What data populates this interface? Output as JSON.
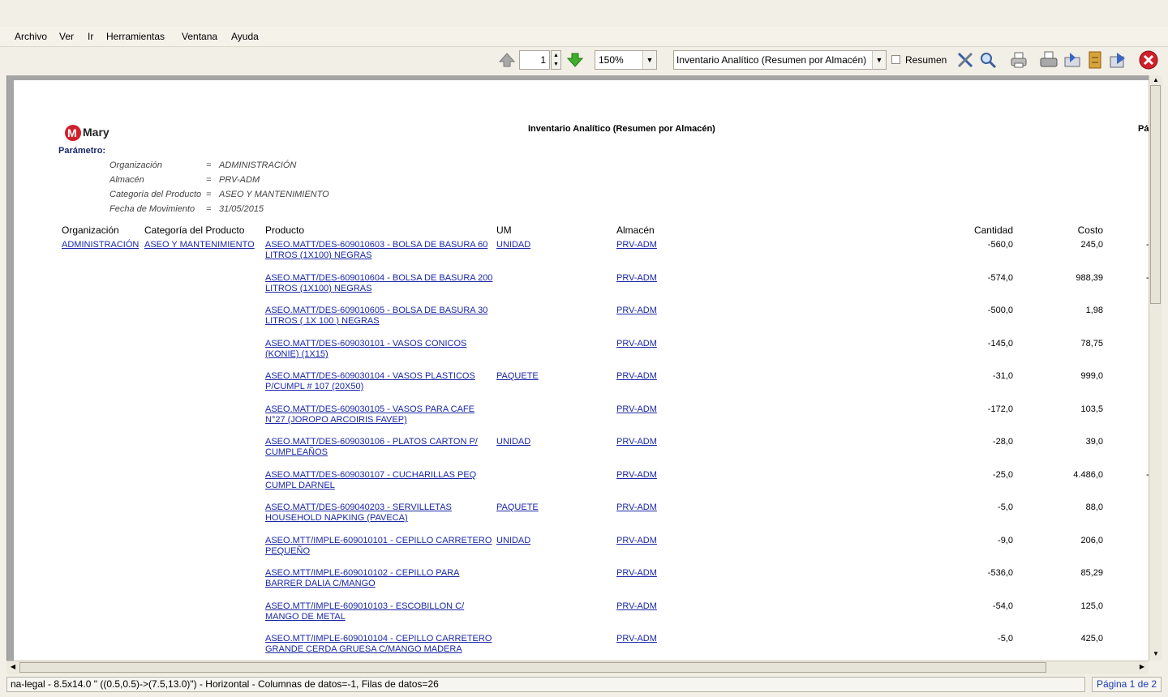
{
  "menu": [
    "Archivo",
    "Ver",
    "Ir",
    "Herramientas",
    "Ventana",
    "Ayuda"
  ],
  "toolbar": {
    "page_value": "1",
    "zoom": "150%",
    "report": "Inventario Analítico (Resumen por Almacén)",
    "summary_label": "Resumen",
    "summary_checked": false
  },
  "report": {
    "logo_text": "Mary",
    "title": "Inventario Analítico (Resumen por Almacén)",
    "page_label_cut": "Pá",
    "param_heading": "Parámetro:",
    "params": [
      {
        "label": "Organización",
        "eq": "=",
        "value": "ADMINISTRACIÓN"
      },
      {
        "label": "Almacén",
        "eq": "=",
        "value": "PRV-ADM"
      },
      {
        "label": "Categoría del Producto",
        "eq": "=",
        "value": "ASEO Y MANTENIMIENTO"
      },
      {
        "label": "Fecha de Movimiento",
        "eq": "=",
        "value": "31/05/2015"
      }
    ],
    "columns": {
      "org": "Organización",
      "cat": "Categoría del Producto",
      "prod": "Producto",
      "um": "UM",
      "alm": "Almacén",
      "cant": "Cantidad",
      "costo": "Costo"
    },
    "org": "ADMINISTRACIÓN",
    "cat": "ASEO Y MANTENIMIENTO",
    "rows": [
      {
        "prod": "ASEO.MATT/DES-609010603 - BOLSA DE BASURA 60 LITROS (1X100) NEGRAS",
        "um": "UNIDAD",
        "alm": "PRV-ADM",
        "cant": "-560,0",
        "costo": "245,0",
        "tail": "-"
      },
      {
        "prod": "ASEO.MATT/DES-609010604 - BOLSA DE BASURA 200 LITROS (1X100) NEGRAS",
        "um": "",
        "alm": "PRV-ADM",
        "cant": "-574,0",
        "costo": "988,39",
        "tail": "-"
      },
      {
        "prod": "ASEO.MATT/DES-609010605 - BOLSA DE BASURA  30 LITROS  ( 1X 100 ) NEGRAS",
        "um": "",
        "alm": "PRV-ADM",
        "cant": "-500,0",
        "costo": "1,98",
        "tail": ""
      },
      {
        "prod": "ASEO.MATT/DES-609030101 - VASOS CONICOS (KONIE) (1X15)",
        "um": "",
        "alm": "PRV-ADM",
        "cant": "-145,0",
        "costo": "78,75",
        "tail": ""
      },
      {
        "prod": "ASEO.MATT/DES-609030104 - VASOS PLASTICOS P/CUMPL # 107 (20X50)",
        "um": "PAQUETE",
        "alm": "PRV-ADM",
        "cant": "-31,0",
        "costo": "999,0",
        "tail": ""
      },
      {
        "prod": "ASEO.MATT/DES-609030105 - VASOS PARA CAFE N°27 (JOROPO ARCOIRIS FAVEP)",
        "um": "",
        "alm": "PRV-ADM",
        "cant": "-172,0",
        "costo": "103,5",
        "tail": ""
      },
      {
        "prod": "ASEO.MATT/DES-609030106 - PLATOS  CARTON P/ CUMPLEAÑOS",
        "um": "UNIDAD",
        "alm": "PRV-ADM",
        "cant": "-28,0",
        "costo": "39,0",
        "tail": ""
      },
      {
        "prod": "ASEO.MATT/DES-609030107 - CUCHARILLAS PEQ  CUMPL DARNEL",
        "um": "",
        "alm": "PRV-ADM",
        "cant": "-25,0",
        "costo": "4.486,0",
        "tail": "-"
      },
      {
        "prod": "ASEO.MATT/DES-609040203 - SERVILLETAS  HOUSEHOLD NAPKING (PAVECA)",
        "um": "PAQUETE",
        "alm": "PRV-ADM",
        "cant": "-5,0",
        "costo": "88,0",
        "tail": ""
      },
      {
        "prod": "ASEO.MTT/IMPLE-609010101 - CEPILLO CARRETERO PEQUEÑO",
        "um": "UNIDAD",
        "alm": "PRV-ADM",
        "cant": "-9,0",
        "costo": "206,0",
        "tail": ""
      },
      {
        "prod": "ASEO.MTT/IMPLE-609010102 - CEPILLO PARA BARRER DALIA C/MANGO",
        "um": "",
        "alm": "PRV-ADM",
        "cant": "-536,0",
        "costo": "85,29",
        "tail": ""
      },
      {
        "prod": "ASEO.MTT/IMPLE-609010103 - ESCOBILLON C/ MANGO DE METAL",
        "um": "",
        "alm": "PRV-ADM",
        "cant": "-54,0",
        "costo": "125,0",
        "tail": ""
      },
      {
        "prod": "ASEO.MTT/IMPLE-609010104 - CEPILLO CARRETERO GRANDE CERDA GRUESA C/MANGO MADERA",
        "um": "",
        "alm": "PRV-ADM",
        "cant": "-5,0",
        "costo": "425,0",
        "tail": ""
      }
    ]
  },
  "status": {
    "text": "na-legal - 8.5x14.0 \" ((0.5,0.5)->(7.5,13.0)\") - Horizontal - Columnas de datos=-1, Filas de datos=26",
    "page": "Página 1 de 2"
  },
  "colors": {
    "link": "#1b27a6",
    "close": "#d0202a",
    "page_status": "#1a3bb3"
  },
  "icons": [
    "arrow-up-icon",
    "arrow-down-icon",
    "tools-icon",
    "search-icon",
    "print-icon",
    "printer-setup-icon",
    "send-icon",
    "archive-icon",
    "export-icon",
    "close-icon"
  ]
}
